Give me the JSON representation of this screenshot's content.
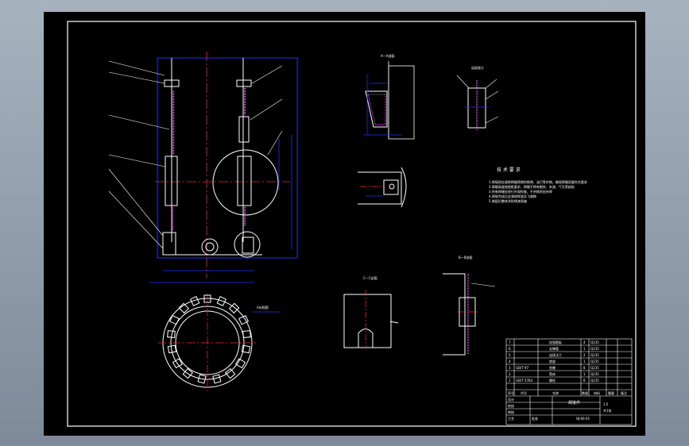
{
  "window": {
    "background": "#000000",
    "frame_color": "#8e9aa9"
  },
  "colors": {
    "outline": "#ffffff",
    "center_line": "#ff2020",
    "dimension": "#2030ff",
    "weld": "#ff40ff",
    "leader": "#ffffff"
  },
  "views": {
    "section_a_label": "A—A剖面",
    "section_b_label": "B—B剖面",
    "section_c_label": "C—C剖面",
    "detail_label": "局部放大",
    "ring_view_label": "A向视图"
  },
  "tech_requirements": {
    "title": "技 术 要 求",
    "items": [
      "1.焊接前应清除焊缝两侧的铁锈、油污等杂物，确保焊缝质量符合要求",
      "2.焊缝高度按图纸要求，焊缝不得有裂纹、夹渣、气孔等缺陷",
      "3.所有焊缝应进行外观检查，不合格的应补焊",
      "4.焊接完成后应清除焊渣及飞溅物",
      "5.装配后整体涂防锈漆两遍"
    ]
  },
  "bom": {
    "rows": [
      {
        "no": "7",
        "code": "",
        "name": "加强筋板",
        "qty": "4",
        "material": "Q235"
      },
      {
        "no": "6",
        "code": "",
        "name": "支撑管",
        "qty": "1",
        "material": "Q235"
      },
      {
        "no": "5",
        "code": "",
        "name": "连接法兰",
        "qty": "2",
        "material": "Q235"
      },
      {
        "no": "4",
        "code": "",
        "name": "底座",
        "qty": "1",
        "material": "Q235"
      },
      {
        "no": "3",
        "code": "GB/T 97",
        "name": "垫圈",
        "qty": "8",
        "material": "Q235"
      },
      {
        "no": "2",
        "code": "",
        "name": "筒体",
        "qty": "1",
        "material": "Q235"
      },
      {
        "no": "1",
        "code": "GB/T 5783",
        "name": "螺栓",
        "qty": "8",
        "material": "Q235"
      }
    ],
    "header": {
      "no": "序号",
      "code": "代号",
      "name": "名称",
      "qty": "数量",
      "material": "材料",
      "weight": "重量",
      "note": "备注"
    },
    "title_block": {
      "drawing_name": "焊接件",
      "scale": "1:5",
      "drawing_no": "HJ-00-01",
      "labels": [
        "设计",
        "校核",
        "审核",
        "工艺",
        "批准"
      ],
      "sheet": "共1张"
    }
  }
}
